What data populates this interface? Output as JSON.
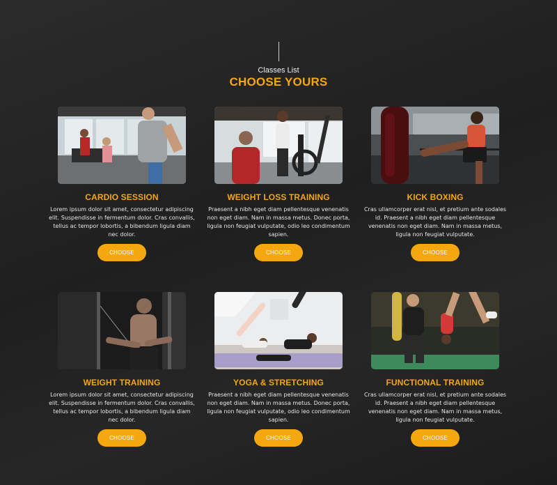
{
  "header": {
    "subtitle": "Classes List",
    "title": "CHOOSE YOURS"
  },
  "accent_color": "#f5a70f",
  "classes": [
    {
      "title": "CARDIO SESSION",
      "text": "Lorem ipsum dolor sit amet, consectetur adipiscing elit. Suspendisse in fermentum dolor. Cras convallis, tellus ac tempor lobortis, a bibendum ligula diam nec dolor.",
      "button": "CHOOSE",
      "image_icon": "treadmill-photo"
    },
    {
      "title": "WEIGHT LOSS TRAINING",
      "text": "Praesent a nibh eget diam pellentesque venenatis non eget diam. Nam in massa metus. Donec porta, ligula non feugiat vulputate, odio leo condimentum sapien.",
      "button": "CHOOSE",
      "image_icon": "elliptical-photo"
    },
    {
      "title": "KICK BOXING",
      "text": "Cras ullamcorper erat nisl, et pretium ante sodales id. Praesent a nibh eget diam pellentesque venenatis non eget diam. Nam in massa metus, ligula non feugiat vulputate.",
      "button": "CHOOSE",
      "image_icon": "kickboxing-photo"
    },
    {
      "title": "WEIGHT TRAINING",
      "text": "Lorem ipsum dolor sit amet, consectetur adipiscing elit. Suspendisse in fermentum dolor. Cras convallis, tellus ac tempor lobortis, a bibendum ligula diam nec dolor.",
      "button": "CHOOSE",
      "image_icon": "cable-machine-photo"
    },
    {
      "title": "YOGA & STRETCHING",
      "text": "Praesent a nibh eget diam pellentesque venenatis non eget diam. Nam in massa metus. Donec porta, ligula non feugiat vulputate, odio leo condimentum sapien.",
      "button": "CHOOSE",
      "image_icon": "yoga-photo"
    },
    {
      "title": "FUNCTIONAL TRAINING",
      "text": "Cras ullamcorper erat nisl, et pretium ante sodales id. Praesent a nibh eget diam pellentesque venenatis non eget diam. Nam in massa metus, ligula non feugiat vulputate.",
      "button": "CHOOSE",
      "image_icon": "functional-training-photo"
    }
  ]
}
